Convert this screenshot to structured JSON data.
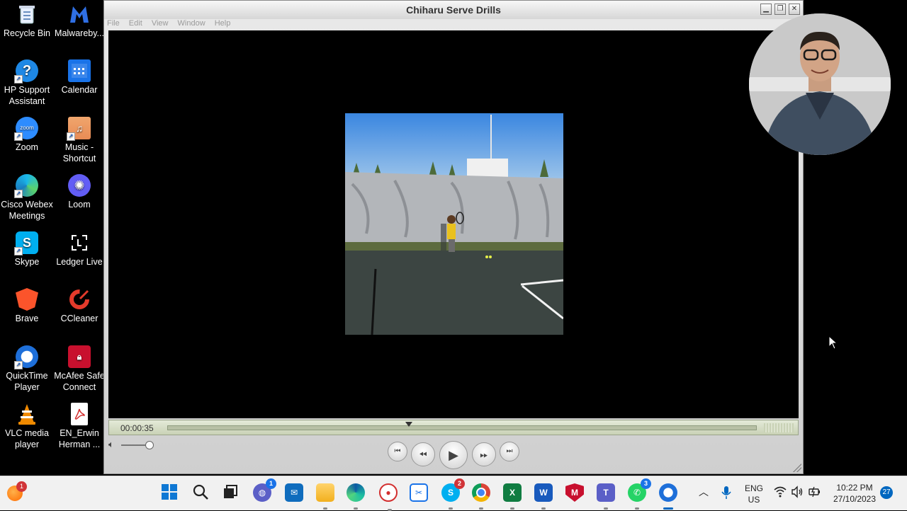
{
  "desktop": {
    "icons": [
      {
        "label": "Recycle Bin"
      },
      {
        "label": "Malwareby..."
      },
      {
        "label": "HP Support Assistant"
      },
      {
        "label": "Calendar"
      },
      {
        "label": "Zoom"
      },
      {
        "label": "Music - Shortcut"
      },
      {
        "label": "Cisco Webex Meetings"
      },
      {
        "label": "Loom"
      },
      {
        "label": "Skype"
      },
      {
        "label": "Ledger Live"
      },
      {
        "label": "Brave"
      },
      {
        "label": "CCleaner"
      },
      {
        "label": "QuickTime Player"
      },
      {
        "label": "McAfee Safe Connect"
      },
      {
        "label": "VLC media player"
      },
      {
        "label": "EN_Erwin Herman ..."
      }
    ],
    "glyphs": {
      "zoom": "zoom",
      "skype": "S",
      "hp": "?"
    }
  },
  "window": {
    "title": "Chiharu Serve Drills",
    "menu": [
      "File",
      "Edit",
      "View",
      "Window",
      "Help"
    ],
    "current_time": "00:00:35",
    "progress": 0.41
  },
  "taskbar": {
    "language": "ENG",
    "region": "US",
    "time": "10:22 PM",
    "date": "27/10/2023",
    "notification_count": "27",
    "badges": {
      "start_alert": "1",
      "chat": "1",
      "skype": "2",
      "whatsapp": "3"
    },
    "app_glyphs": {
      "skype": "S",
      "excel": "X",
      "word": "W",
      "teams": "T"
    }
  },
  "colors": {
    "accent_blue": "#0067c0",
    "desktop_bg": "#000000",
    "scrubber": "#c9d2b6"
  }
}
